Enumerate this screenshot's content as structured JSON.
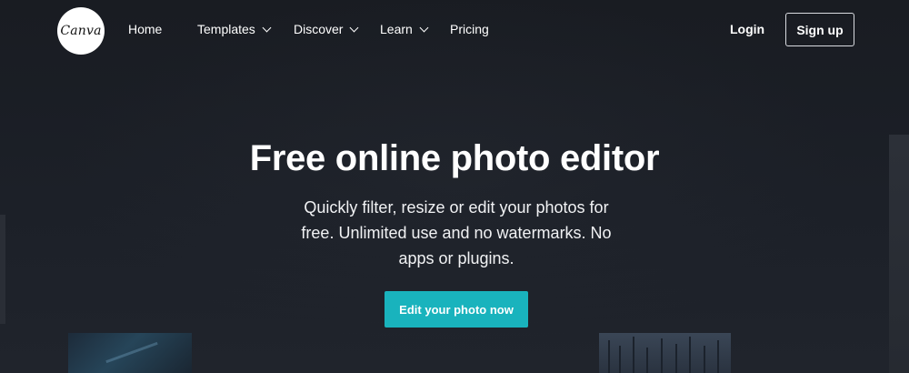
{
  "header": {
    "logo_text": "Canva",
    "nav": {
      "home": "Home",
      "templates": "Templates",
      "discover": "Discover",
      "learn": "Learn",
      "pricing": "Pricing"
    },
    "login": "Login",
    "signup": "Sign up"
  },
  "hero": {
    "title": "Free online photo editor",
    "subtitle": "Quickly filter, resize or edit your photos for free. Unlimited use and no watermarks. No apps or plugins.",
    "cta": "Edit your photo now"
  },
  "colors": {
    "background": "#1b1e24",
    "accent": "#19b3bd",
    "text": "#ffffff"
  },
  "icons": {
    "dropdown": "chevron-down-icon"
  }
}
